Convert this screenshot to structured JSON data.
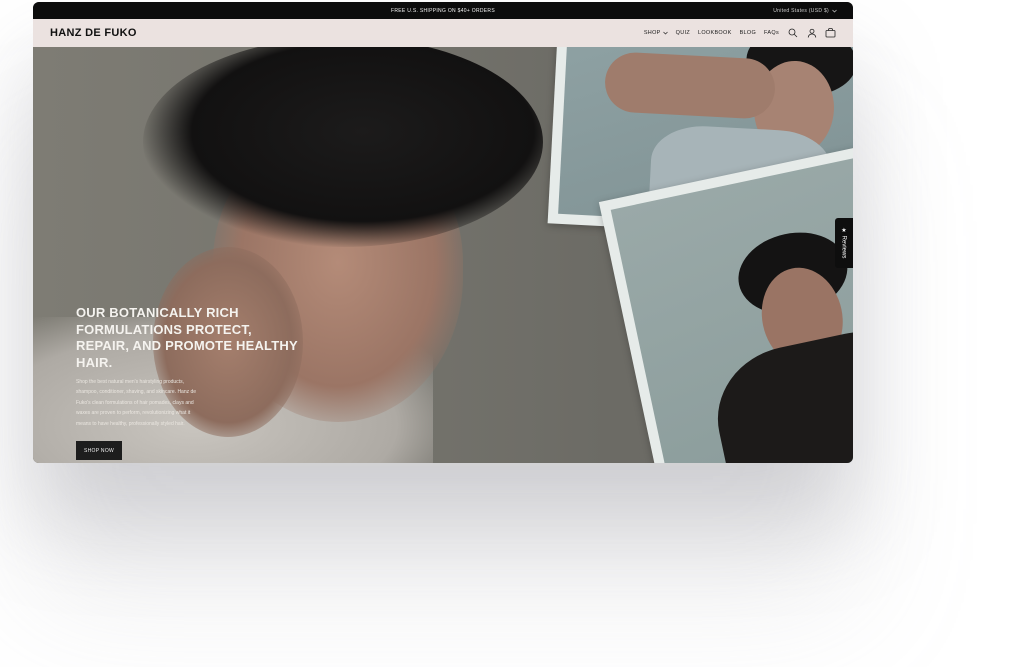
{
  "announcement": {
    "text": "FREE U.S. SHIPPING ON $40+ ORDERS",
    "region": "United States (USD $)"
  },
  "header": {
    "logo": "HANZ DE FUKO",
    "nav": [
      {
        "label": "SHOP"
      },
      {
        "label": "QUIZ"
      },
      {
        "label": "LOOKBOOK"
      },
      {
        "label": "BLOG"
      },
      {
        "label": "FAQs"
      }
    ],
    "icons": [
      "search-icon",
      "account-icon",
      "bag-icon"
    ]
  },
  "hero": {
    "headline": "OUR BOTANICALLY RICH FORMULATIONS PROTECT, REPAIR, AND PROMOTE HEALTHY HAIR.",
    "subtext": "Shop the best natural men's hairstyling products, shampoo, conditioner, shaving, and skincare. Hanz de Fuko's clean formulations of hair pomades, clays and waxes are proven to perform, revolutionizing what it means to have healthy, professionally styled hair.",
    "cta": "SHOP NOW"
  },
  "reviews_tab": {
    "label": "★ Reviews"
  }
}
